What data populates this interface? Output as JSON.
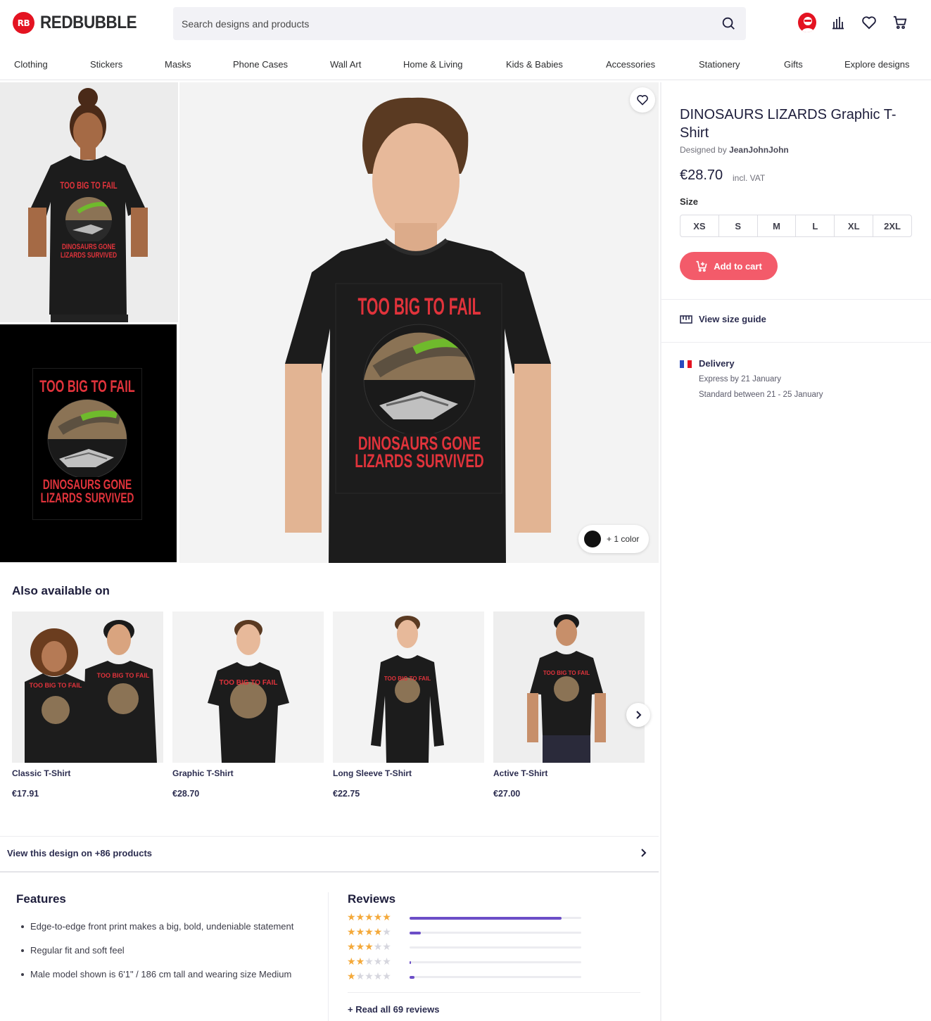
{
  "brand": {
    "name": "REDBUBBLE",
    "mark": "RB",
    "accent": "#e41321"
  },
  "search": {
    "placeholder": "Search designs and products"
  },
  "header_icons": [
    "avatar",
    "bar-chart-icon",
    "heart-icon",
    "cart-icon"
  ],
  "nav": [
    "Clothing",
    "Stickers",
    "Masks",
    "Phone Cases",
    "Wall Art",
    "Home & Living",
    "Kids & Babies",
    "Accessories",
    "Stationery",
    "Gifts",
    "Explore designs"
  ],
  "design": {
    "line1": "TOO BIG TO FAIL",
    "line2": "DINOSAURS GONE",
    "line3": "LIZARDS SURVIVED",
    "text_color": "#e0333b"
  },
  "product": {
    "title": "DINOSAURS LIZARDS Graphic T-Shirt",
    "designed_prefix": "Designed by",
    "designer": "JeanJohnJohn",
    "price": "€28.70",
    "vat": "incl. VAT",
    "size_label": "Size",
    "sizes": [
      "XS",
      "S",
      "M",
      "L",
      "XL",
      "2XL"
    ],
    "add_to_cart": "Add to cart",
    "color_more": "+ 1 color",
    "cart_color": "#f35b6a"
  },
  "size_guide": "View size guide",
  "delivery": {
    "title": "Delivery",
    "express": "Express by 21 January",
    "standard": "Standard between 21 - 25 January"
  },
  "also": {
    "title": "Also available on",
    "items": [
      {
        "name": "Classic T-Shirt",
        "price": "€17.91"
      },
      {
        "name": "Graphic T-Shirt",
        "price": "€28.70"
      },
      {
        "name": "Long Sleeve T-Shirt",
        "price": "€22.75"
      },
      {
        "name": "Active T-Shirt",
        "price": "€27.00"
      }
    ]
  },
  "view_design": "View this design on +86 products",
  "features": {
    "title": "Features",
    "items": [
      "Edge-to-edge front print makes a big, bold, undeniable statement",
      "Regular fit and soft feel",
      "Male model shown is 6'1\" / 186 cm tall and wearing size Medium"
    ]
  },
  "reviews": {
    "title": "Reviews",
    "rows": [
      {
        "stars": 5,
        "fraction": 0.885
      },
      {
        "stars": 4,
        "fraction": 0.065
      },
      {
        "stars": 3,
        "fraction": 0.0
      },
      {
        "stars": 2,
        "fraction": 0.01
      },
      {
        "stars": 1,
        "fraction": 0.03
      }
    ],
    "read_all": "+ Read all 69 reviews",
    "bar_color": "#6c4ec7",
    "star_color": "#f4a93a"
  }
}
